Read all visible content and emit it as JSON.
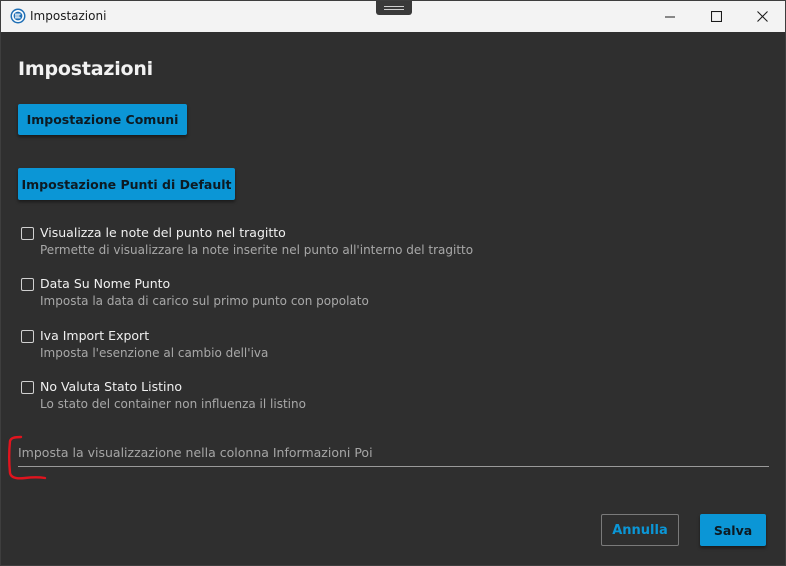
{
  "window": {
    "title": "Impostazioni"
  },
  "page": {
    "title": "Impostazioni"
  },
  "buttons": {
    "comuni": "Impostazione Comuni",
    "punti_default": "Impostazione Punti di Default",
    "annulla": "Annulla",
    "salva": "Salva"
  },
  "options": [
    {
      "label": "Visualizza le note del punto nel tragitto",
      "description": "Permette di visualizzare la note inserite nel punto all'interno del tragitto",
      "checked": false
    },
    {
      "label": "Data Su Nome Punto",
      "description": "Imposta la data di carico sul primo punto con popolato",
      "checked": false
    },
    {
      "label": "Iva Import Export",
      "description": "Imposta l'esenzione al cambio dell'iva",
      "checked": false
    },
    {
      "label": "No Valuta Stato Listino",
      "description": "Lo stato del container non influenza il listino",
      "checked": false
    }
  ],
  "poi_field": {
    "placeholder": "Imposta la visualizzazione nella colonna Informazioni Poi",
    "value": ""
  },
  "colors": {
    "accent": "#0b96d6",
    "background": "#2f2f2f",
    "annotation": "#e0141e"
  },
  "icons": {
    "app": "app-logo-icon",
    "minimize": "minimize-icon",
    "maximize": "maximize-icon",
    "close": "close-icon"
  }
}
